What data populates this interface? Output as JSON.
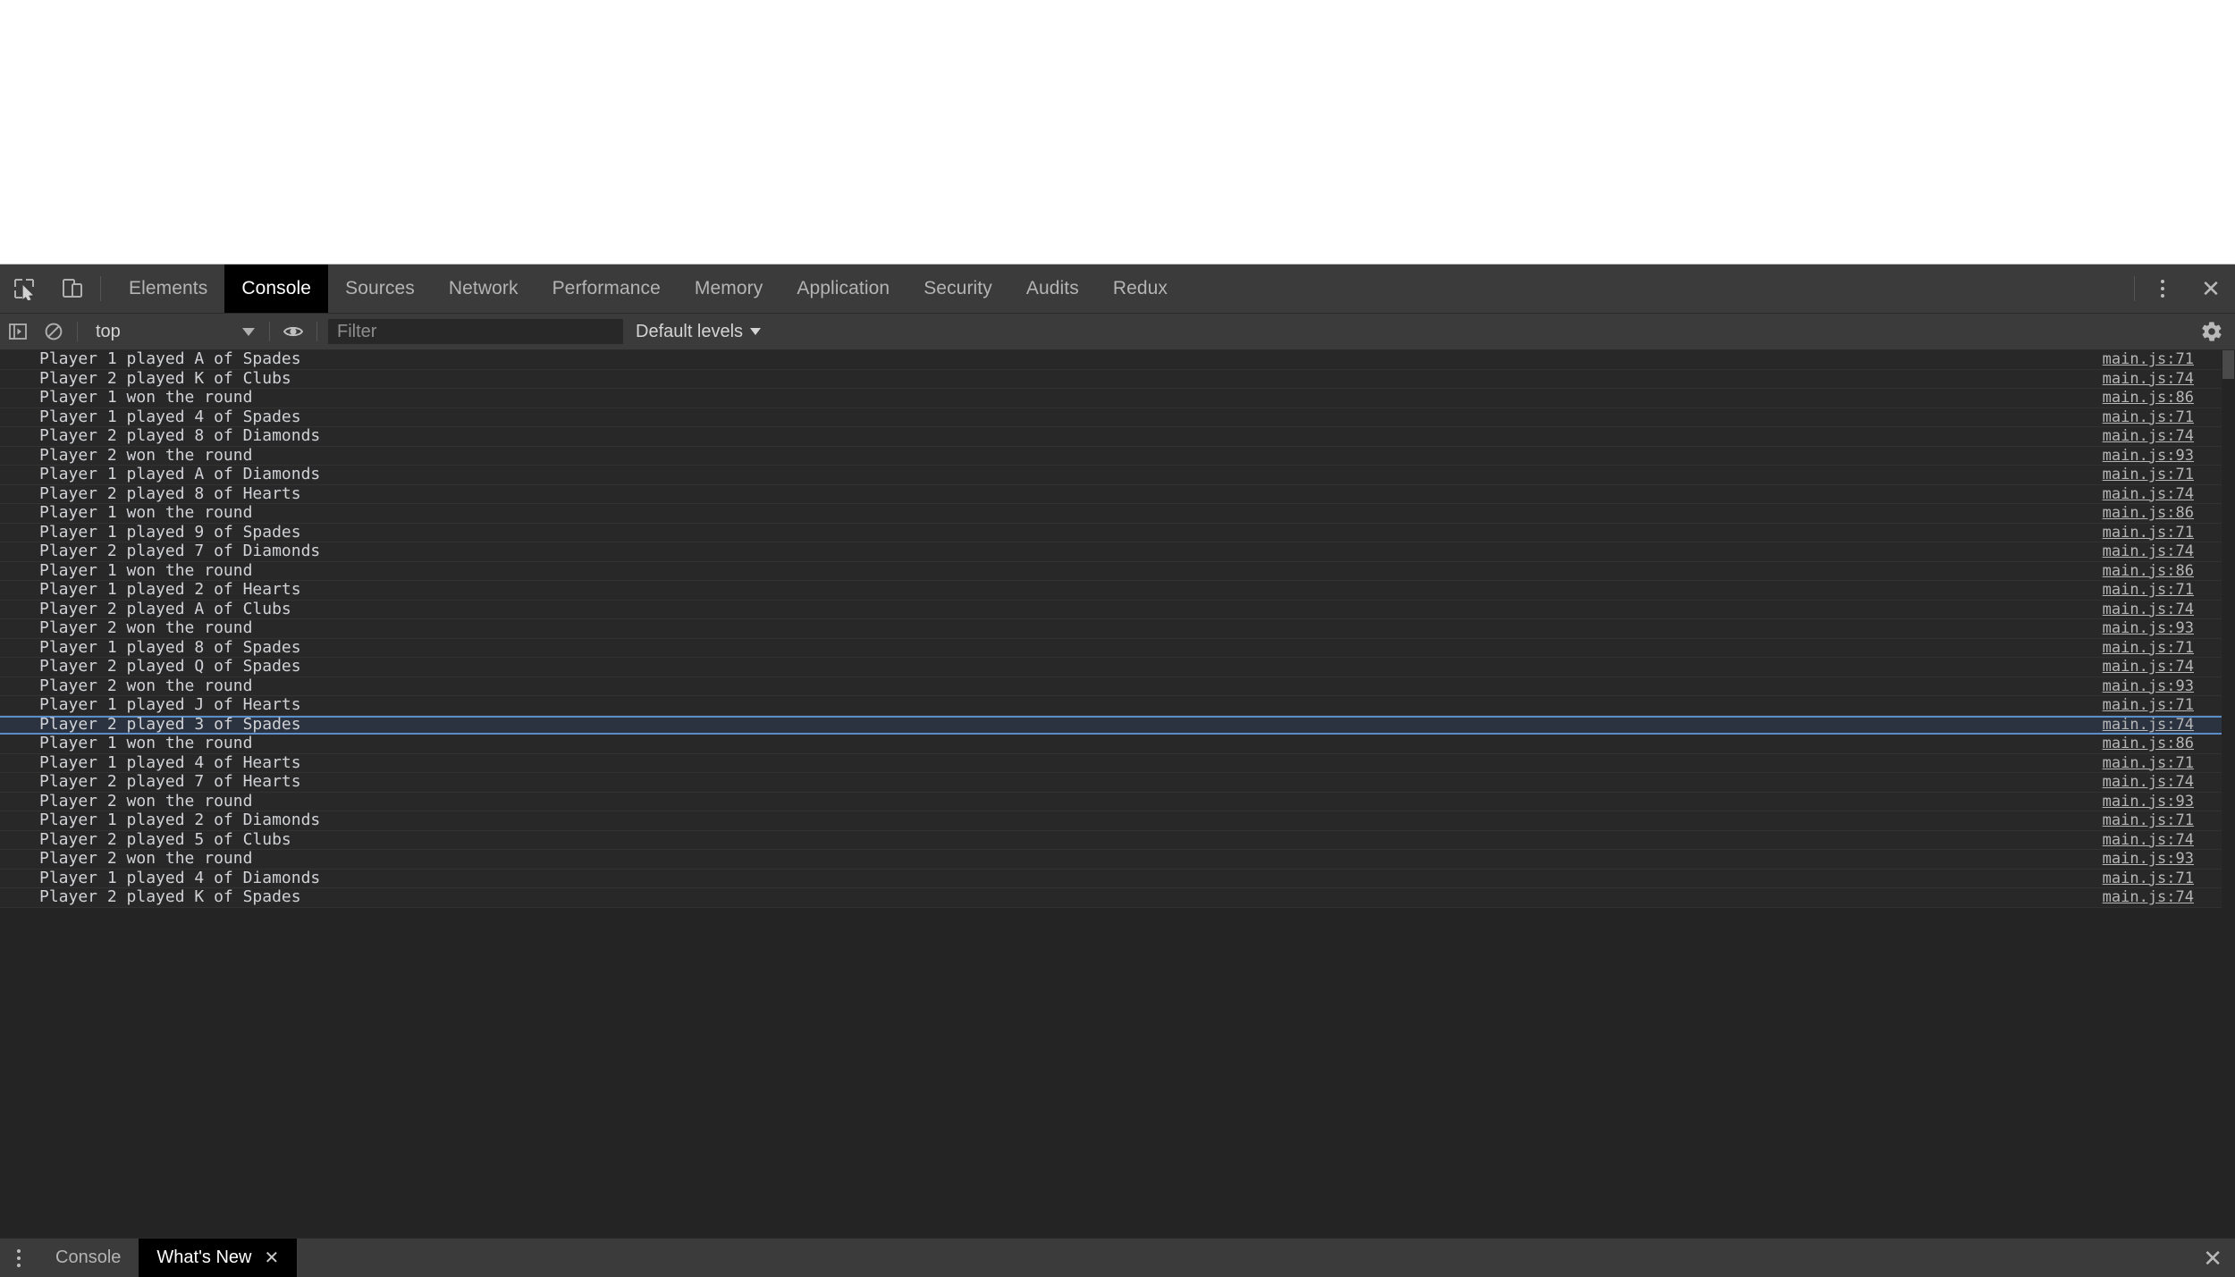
{
  "window": {
    "page_background": "#ffffff",
    "devtools_background": "#242424",
    "accent_selection": "#5b8ec9"
  },
  "toolbar": {
    "icons": [
      {
        "name": "inspect-element-icon",
        "title": "Inspect element"
      },
      {
        "name": "device-toolbar-icon",
        "title": "Toggle device toolbar"
      }
    ],
    "tabs": [
      {
        "label": "Elements",
        "selected": false
      },
      {
        "label": "Console",
        "selected": true
      },
      {
        "label": "Sources",
        "selected": false
      },
      {
        "label": "Network",
        "selected": false
      },
      {
        "label": "Performance",
        "selected": false
      },
      {
        "label": "Memory",
        "selected": false
      },
      {
        "label": "Application",
        "selected": false
      },
      {
        "label": "Security",
        "selected": false
      },
      {
        "label": "Audits",
        "selected": false
      },
      {
        "label": "Redux",
        "selected": false
      }
    ],
    "more_label": "⋮",
    "close_label": "✕"
  },
  "filterbar": {
    "sidebar_toggle_icon": "console-sidebar-icon",
    "clear_icon": "clear-console-icon",
    "context": {
      "value": "top",
      "caret": "▼"
    },
    "eye_icon": "live-expression-eye-icon",
    "filter": {
      "value": "",
      "placeholder": "Filter"
    },
    "levels": {
      "label": "Default levels",
      "caret": "▼"
    },
    "settings_icon": "gear-icon"
  },
  "console": {
    "source_file": "main.js",
    "messages": [
      {
        "text": "Player 1 played A of Spades",
        "source": "main.js:71",
        "selected": false
      },
      {
        "text": "Player 2 played K of Clubs",
        "source": "main.js:74",
        "selected": false
      },
      {
        "text": "Player 1 won the round",
        "source": "main.js:86",
        "selected": false
      },
      {
        "text": "Player 1 played 4 of Spades",
        "source": "main.js:71",
        "selected": false
      },
      {
        "text": "Player 2 played 8 of Diamonds",
        "source": "main.js:74",
        "selected": false
      },
      {
        "text": "Player 2 won the round",
        "source": "main.js:93",
        "selected": false
      },
      {
        "text": "Player 1 played A of Diamonds",
        "source": "main.js:71",
        "selected": false
      },
      {
        "text": "Player 2 played 8 of Hearts",
        "source": "main.js:74",
        "selected": false
      },
      {
        "text": "Player 1 won the round",
        "source": "main.js:86",
        "selected": false
      },
      {
        "text": "Player 1 played 9 of Spades",
        "source": "main.js:71",
        "selected": false
      },
      {
        "text": "Player 2 played 7 of Diamonds",
        "source": "main.js:74",
        "selected": false
      },
      {
        "text": "Player 1 won the round",
        "source": "main.js:86",
        "selected": false
      },
      {
        "text": "Player 1 played 2 of Hearts",
        "source": "main.js:71",
        "selected": false
      },
      {
        "text": "Player 2 played A of Clubs",
        "source": "main.js:74",
        "selected": false
      },
      {
        "text": "Player 2 won the round",
        "source": "main.js:93",
        "selected": false
      },
      {
        "text": "Player 1 played 8 of Spades",
        "source": "main.js:71",
        "selected": false
      },
      {
        "text": "Player 2 played Q of Spades",
        "source": "main.js:74",
        "selected": false
      },
      {
        "text": "Player 2 won the round",
        "source": "main.js:93",
        "selected": false
      },
      {
        "text": "Player 1 played J of Hearts",
        "source": "main.js:71",
        "selected": false
      },
      {
        "text": "Player 2 played 3 of Spades",
        "source": "main.js:74",
        "selected": true
      },
      {
        "text": "Player 1 won the round",
        "source": "main.js:86",
        "selected": false
      },
      {
        "text": "Player 1 played 4 of Hearts",
        "source": "main.js:71",
        "selected": false
      },
      {
        "text": "Player 2 played 7 of Hearts",
        "source": "main.js:74",
        "selected": false
      },
      {
        "text": "Player 2 won the round",
        "source": "main.js:93",
        "selected": false
      },
      {
        "text": "Player 1 played 2 of Diamonds",
        "source": "main.js:71",
        "selected": false
      },
      {
        "text": "Player 2 played 5 of Clubs",
        "source": "main.js:74",
        "selected": false
      },
      {
        "text": "Player 2 won the round",
        "source": "main.js:93",
        "selected": false
      },
      {
        "text": "Player 1 played 4 of Diamonds",
        "source": "main.js:71",
        "selected": false
      },
      {
        "text": "Player 2 played K of Spades",
        "source": "main.js:74",
        "selected": false
      }
    ]
  },
  "drawer": {
    "menu_label": "⋮",
    "tabs": [
      {
        "label": "Console",
        "selected": false,
        "closable": false
      },
      {
        "label": "What's New",
        "selected": true,
        "closable": true,
        "close_label": "✕"
      }
    ],
    "close_label": "✕"
  }
}
